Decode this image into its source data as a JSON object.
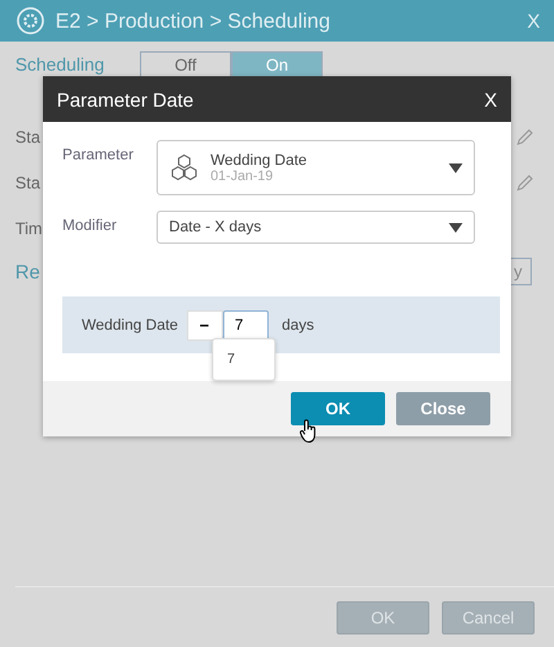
{
  "window": {
    "title": "E2 > Production > Scheduling",
    "close": "X"
  },
  "background": {
    "scheduling_label": "Scheduling",
    "toggle": [
      {
        "label": "Off",
        "selected": false
      },
      {
        "label": "On",
        "selected": true
      }
    ],
    "rows": [
      {
        "label": "Sta",
        "kind": "edit"
      },
      {
        "label": "Sta",
        "kind": "edit"
      },
      {
        "label": "Tim",
        "kind": "plain"
      }
    ],
    "section_label": "Re",
    "section_button": "y"
  },
  "dialog": {
    "title": "Parameter Date",
    "close": "X",
    "parameter": {
      "label": "Parameter",
      "name": "Wedding Date",
      "date": "01-Jan-19"
    },
    "modifier": {
      "label": "Modifier",
      "value": "Date - X days"
    },
    "offset": {
      "label": "Wedding Date",
      "sign": "−",
      "value": "7",
      "unit": "days",
      "suggestions": [
        "7"
      ]
    },
    "buttons": [
      {
        "label": "OK",
        "kind": "primary"
      },
      {
        "label": "Close",
        "kind": "secondary"
      }
    ]
  },
  "footer_buttons": [
    "OK",
    "Cancel"
  ]
}
